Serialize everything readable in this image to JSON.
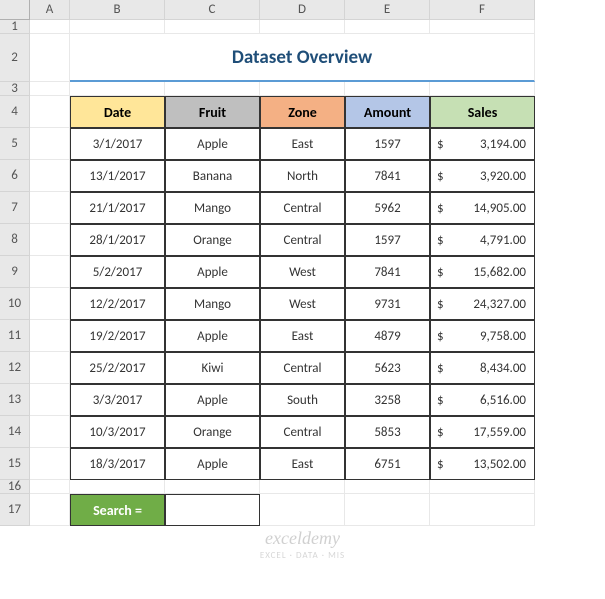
{
  "columns": [
    "A",
    "B",
    "C",
    "D",
    "E",
    "F"
  ],
  "rowNumbers": [
    "1",
    "2",
    "3",
    "4",
    "5",
    "6",
    "7",
    "8",
    "9",
    "10",
    "11",
    "12",
    "13",
    "14",
    "15",
    "16",
    "17"
  ],
  "title": "Dataset Overview",
  "headers": {
    "date": "Date",
    "fruit": "Fruit",
    "zone": "Zone",
    "amount": "Amount",
    "sales": "Sales"
  },
  "rows": [
    {
      "date": "3/1/2017",
      "fruit": "Apple",
      "zone": "East",
      "amount": "1597",
      "sales": "3,194.00"
    },
    {
      "date": "13/1/2017",
      "fruit": "Banana",
      "zone": "North",
      "amount": "7841",
      "sales": "3,920.00"
    },
    {
      "date": "21/1/2017",
      "fruit": "Mango",
      "zone": "Central",
      "amount": "5962",
      "sales": "14,905.00"
    },
    {
      "date": "28/1/2017",
      "fruit": "Orange",
      "zone": "Central",
      "amount": "1597",
      "sales": "4,791.00"
    },
    {
      "date": "5/2/2017",
      "fruit": "Apple",
      "zone": "West",
      "amount": "7841",
      "sales": "15,682.00"
    },
    {
      "date": "12/2/2017",
      "fruit": "Mango",
      "zone": "West",
      "amount": "9731",
      "sales": "24,327.00"
    },
    {
      "date": "19/2/2017",
      "fruit": "Apple",
      "zone": "East",
      "amount": "4879",
      "sales": "9,758.00"
    },
    {
      "date": "25/2/2017",
      "fruit": "Kiwi",
      "zone": "Central",
      "amount": "5623",
      "sales": "8,434.00"
    },
    {
      "date": "3/3/2017",
      "fruit": "Apple",
      "zone": "South",
      "amount": "3258",
      "sales": "6,516.00"
    },
    {
      "date": "10/3/2017",
      "fruit": "Orange",
      "zone": "Central",
      "amount": "5853",
      "sales": "17,559.00"
    },
    {
      "date": "18/3/2017",
      "fruit": "Apple",
      "zone": "East",
      "amount": "6751",
      "sales": "13,502.00"
    }
  ],
  "currency": "$",
  "search": {
    "label": "Search ="
  },
  "watermark": {
    "main": "exceldemy",
    "sub": "EXCEL · DATA · MIS"
  }
}
